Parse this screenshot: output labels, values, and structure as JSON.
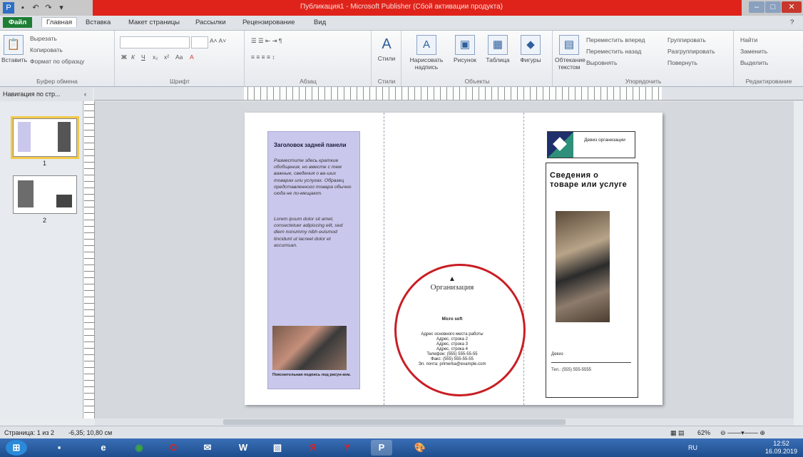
{
  "window": {
    "title": "Публикация1 - Microsoft Publisher (Сбой активации продукта)"
  },
  "tabs": [
    "Файл",
    "Главная",
    "Вставка",
    "Макет страницы",
    "Рассылки",
    "Рецензирование",
    "Вид"
  ],
  "ribbon": {
    "clipboard": {
      "paste": "Вставить",
      "cut": "Вырезать",
      "copy": "Копировать",
      "format": "Формат по образцу",
      "label": "Буфер обмена"
    },
    "font": {
      "label": "Шрифт"
    },
    "paragraph": {
      "label": "Абзац"
    },
    "styles": {
      "button": "Стили",
      "label": "Стили"
    },
    "objects": {
      "textbox": "Нарисовать надпись",
      "picture": "Рисунок",
      "table": "Таблица",
      "shapes": "Фигуры",
      "label": "Объекты"
    },
    "arrange": {
      "wrap": "Обтекание текстом",
      "forward": "Переместить вперед",
      "backward": "Переместить назад",
      "align": "Выровнять",
      "group": "Группировать",
      "ungroup": "Разгруппировать",
      "rotate": "Повернуть",
      "label": "Упорядочить"
    },
    "editing": {
      "find": "Найти",
      "replace": "Заменить",
      "select": "Выделить",
      "label": "Редактирование"
    }
  },
  "nav": {
    "header": "Навигация по стр...",
    "pages": [
      {
        "num": "1"
      },
      {
        "num": "2"
      }
    ]
  },
  "publication": {
    "panel1": {
      "heading": "Заголовок задней панели",
      "body1": "Разместите здесь краткие обобщения, но вместе с тем важные, сведения о ва-ших товарах или услугах. Образец представленного товара обычно сюда не по-мещают.",
      "body2": "Lorem ipsum dolor sit amet, consectetuer adipiscing elit, sed diem nonummy nibh euismod tincidunt ut lacreet dolor et accumsan.",
      "caption": "Пояснительная подпись под рисун-ком."
    },
    "panel2": {
      "org": "Организация",
      "company": "Micro soft",
      "address": [
        "Адрес основного места работы",
        "Адрес, строка 2",
        "Адрес, строка 3",
        "Адрес, строка 4"
      ],
      "phone": "Телефон: (555) 555-55-55",
      "fax": "Факс: (555) 555-55-55",
      "email": "Эл. почта: primerka@example.com"
    },
    "panel3": {
      "org_name": "Девиз организации",
      "title": "Сведения о товаре или услуге",
      "slogan": "Девиз",
      "phone": "Тел.: (555) 555-5555"
    }
  },
  "status": {
    "page": "Страница: 1 из 2",
    "position": "-6,35; 10,80 см",
    "zoom": "62%"
  },
  "taskbar": {
    "lang": "RU",
    "time": "12:52",
    "date": "16.09.2019"
  }
}
